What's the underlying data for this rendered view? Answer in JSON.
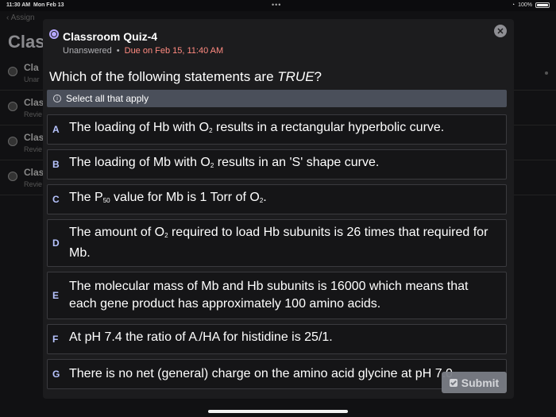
{
  "status_bar": {
    "time": "11:30 AM",
    "date": "Mon Feb 13",
    "dots": "•••",
    "battery": "100%"
  },
  "background": {
    "back_label": "Assign",
    "title": "Clas",
    "rows": [
      {
        "title": "Cla",
        "subtitle": "Unar"
      },
      {
        "title": "Clas",
        "subtitle": "Revie"
      },
      {
        "title": "Clas",
        "subtitle": "Revie"
      },
      {
        "title": "Clas",
        "subtitle": "Revie"
      }
    ]
  },
  "modal": {
    "title": "Classroom Quiz-4",
    "status": "Unanswered",
    "separator": "•",
    "due": "Due on Feb 15, 11:40 AM",
    "close_symbol": "✕",
    "question_prefix": "Which of the following statements are ",
    "question_emphasis": "TRUE",
    "question_suffix": "?",
    "instruction": "Select all that apply",
    "info_symbol": "i",
    "submit_label": "Submit"
  },
  "options": [
    {
      "letter": "A",
      "parts": [
        "The loading of Hb with O",
        "2",
        " results in a rectangular hyperbolic curve."
      ]
    },
    {
      "letter": "B",
      "parts": [
        "The loading of Mb with O",
        "2",
        " results in an 'S' shape curve."
      ]
    },
    {
      "letter": "C",
      "parts": [
        "The P",
        "50",
        " value for Mb is 1 Torr of O",
        "2",
        "."
      ]
    },
    {
      "letter": "D",
      "parts": [
        "The amount of O",
        "2",
        " required to load Hb subunits is 26 times that required for Mb."
      ]
    },
    {
      "letter": "E",
      "parts": [
        "The molecular mass of Mb and Hb subunits is 16000 which means that each gene product has approximately 100 amino acids."
      ]
    },
    {
      "letter": "F",
      "parts": [
        "At pH 7.4 the ratio of A",
        "-",
        "/HA for histidine is 25/1."
      ]
    },
    {
      "letter": "G",
      "parts": [
        "There is no net (general) charge on the amino acid glycine at pH 7.0"
      ]
    }
  ],
  "colors": {
    "accent": "#b7c4ff",
    "due": "#ff8a80",
    "banner": "#4a4f5a"
  }
}
